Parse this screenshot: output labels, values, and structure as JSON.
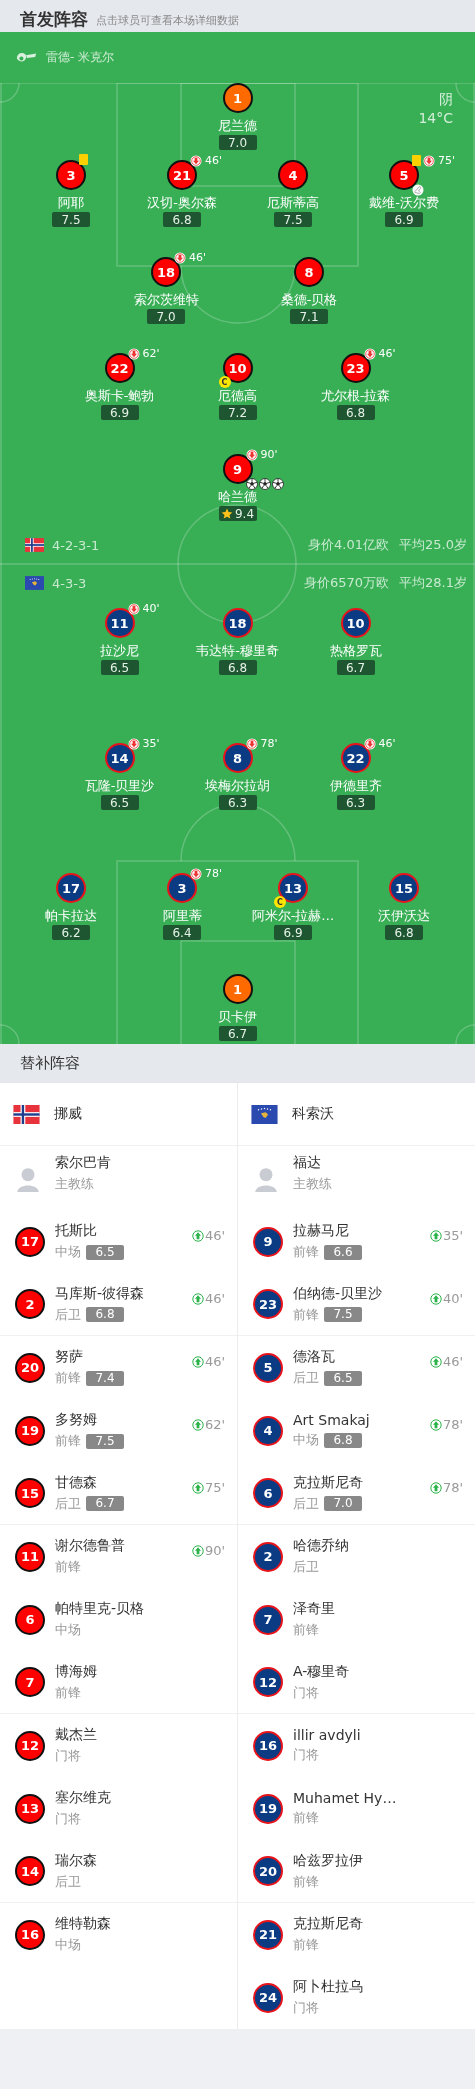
{
  "header": {
    "title": "首发阵容",
    "hint": "点击球员可查看本场详细数据"
  },
  "lineup": {
    "referee": "雷德- 米克尔",
    "weather": {
      "condition": "阴",
      "temperature": "14°C"
    },
    "home": {
      "formation": "4-2-3-1",
      "value": "身价4.01亿欧",
      "avg_age": "平均25.0岁",
      "lines": [
        [
          {
            "number": "1",
            "name": "尼兰德",
            "rating": "7.0",
            "kind": "goalkeeper",
            "yellow_card": false,
            "mvp": false
          }
        ],
        [
          {
            "number": "3",
            "name": "阿耶",
            "rating": "7.5",
            "kind": "outfield",
            "yellow_card": true,
            "mvp": false
          },
          {
            "number": "21",
            "name": "汉切-奥尔森",
            "rating": "6.8",
            "kind": "outfield",
            "yellow_card": false,
            "mvp": false,
            "sub_minute": "46'"
          },
          {
            "number": "4",
            "name": "厄斯蒂高",
            "rating": "7.5",
            "kind": "outfield",
            "yellow_card": false,
            "mvp": false
          },
          {
            "number": "5",
            "name": "戴维-沃尔费",
            "rating": "6.9",
            "kind": "outfield",
            "yellow_card": true,
            "mvp": false,
            "sub_minute": "75'",
            "events": [
              {
                "kind": "assist"
              }
            ]
          }
        ],
        [
          {
            "number": "18",
            "name": "索尔茨维特",
            "rating": "7.0",
            "kind": "outfield",
            "yellow_card": false,
            "mvp": false,
            "sub_minute": "46'"
          },
          {
            "number": "8",
            "name": "桑德-贝格",
            "rating": "7.1",
            "kind": "outfield",
            "yellow_card": false,
            "mvp": false
          }
        ],
        [
          {
            "number": "22",
            "name": "奥斯卡-鲍勃",
            "rating": "6.9",
            "kind": "outfield",
            "yellow_card": false,
            "mvp": false,
            "sub_minute": "62'"
          },
          {
            "number": "10",
            "name": "厄德高",
            "rating": "7.2",
            "kind": "outfield",
            "yellow_card": false,
            "mvp": false,
            "captain": "C"
          },
          {
            "number": "23",
            "name": "尤尔根-拉森",
            "rating": "6.8",
            "kind": "outfield",
            "yellow_card": false,
            "mvp": false,
            "sub_minute": "46'"
          }
        ],
        [
          {
            "number": "9",
            "name": "哈兰德",
            "rating": "9.4",
            "kind": "outfield",
            "yellow_card": false,
            "mvp": true,
            "sub_minute": "90'",
            "events": [
              {
                "kind": "goal"
              },
              {
                "kind": "goal"
              },
              {
                "kind": "goal"
              }
            ]
          }
        ]
      ]
    },
    "away": {
      "formation": "4-3-3",
      "value": "身价6570万欧",
      "avg_age": "平均28.1岁",
      "lines": [
        [
          {
            "number": "11",
            "name": "拉沙尼",
            "rating": "6.5",
            "kind": "outfield",
            "yellow_card": false,
            "mvp": false,
            "sub_minute": "40'"
          },
          {
            "number": "18",
            "name": "韦达特-穆里奇",
            "rating": "6.8",
            "kind": "outfield",
            "yellow_card": false,
            "mvp": false
          },
          {
            "number": "10",
            "name": "热格罗瓦",
            "rating": "6.7",
            "kind": "outfield",
            "yellow_card": false,
            "mvp": false
          }
        ],
        [
          {
            "number": "14",
            "name": "瓦隆-贝里沙",
            "rating": "6.5",
            "kind": "outfield",
            "yellow_card": false,
            "mvp": false,
            "sub_minute": "35'"
          },
          {
            "number": "8",
            "name": "埃梅尔拉胡",
            "rating": "6.3",
            "kind": "outfield",
            "yellow_card": false,
            "mvp": false,
            "sub_minute": "78'"
          },
          {
            "number": "22",
            "name": "伊德里齐",
            "rating": "6.3",
            "kind": "outfield",
            "yellow_card": false,
            "mvp": false,
            "sub_minute": "46'"
          }
        ],
        [
          {
            "number": "17",
            "name": "帕卡拉达",
            "rating": "6.2",
            "kind": "outfield",
            "yellow_card": false,
            "mvp": false
          },
          {
            "number": "3",
            "name": "阿里蒂",
            "rating": "6.4",
            "kind": "outfield",
            "yellow_card": false,
            "mvp": false,
            "sub_minute": "78'"
          },
          {
            "number": "13",
            "name": "阿米尔-拉赫…",
            "rating": "6.9",
            "kind": "outfield",
            "yellow_card": false,
            "mvp": false,
            "captain": "C"
          },
          {
            "number": "15",
            "name": "沃伊沃达",
            "rating": "6.8",
            "kind": "outfield",
            "yellow_card": false,
            "mvp": false
          }
        ],
        [
          {
            "number": "1",
            "name": "贝卡伊",
            "rating": "6.7",
            "kind": "goalkeeper",
            "yellow_card": false,
            "mvp": false
          }
        ]
      ]
    }
  },
  "substitutes": {
    "title": "替补阵容",
    "teams": [
      {
        "name": "挪威",
        "coach": {
          "name": "索尔巴肯",
          "role": "主教练"
        },
        "players": [
          {
            "number": "17",
            "name": "托斯比",
            "position": "中场",
            "rating": "6.5",
            "sub_minute": "46'"
          },
          {
            "number": "2",
            "name": "马库斯-彼得森",
            "position": "后卫",
            "rating": "6.8",
            "sub_minute": "46'"
          },
          {
            "number": "20",
            "name": "努萨",
            "position": "前锋",
            "rating": "7.4",
            "sub_minute": "46'"
          },
          {
            "number": "19",
            "name": "多努姆",
            "position": "前锋",
            "rating": "7.5",
            "sub_minute": "62'"
          },
          {
            "number": "15",
            "name": "甘德森",
            "position": "后卫",
            "rating": "6.7",
            "sub_minute": "75'"
          },
          {
            "number": "11",
            "name": "谢尔德鲁普",
            "position": "前锋",
            "sub_minute": "90'"
          },
          {
            "number": "6",
            "name": "帕特里克-贝格",
            "position": "中场"
          },
          {
            "number": "7",
            "name": "博海姆",
            "position": "前锋"
          },
          {
            "number": "12",
            "name": "戴杰兰",
            "position": "门将"
          },
          {
            "number": "13",
            "name": "塞尔维克",
            "position": "门将"
          },
          {
            "number": "14",
            "name": "瑞尔森",
            "position": "后卫"
          },
          {
            "number": "16",
            "name": "维特勒森",
            "position": "中场"
          }
        ]
      },
      {
        "name": "科索沃",
        "coach": {
          "name": "福达",
          "role": "主教练"
        },
        "players": [
          {
            "number": "9",
            "name": "拉赫马尼",
            "position": "前锋",
            "rating": "6.6",
            "sub_minute": "35'"
          },
          {
            "number": "23",
            "name": "伯纳德-贝里沙",
            "position": "前锋",
            "rating": "7.5",
            "sub_minute": "40'"
          },
          {
            "number": "5",
            "name": "德洛瓦",
            "position": "后卫",
            "rating": "6.5",
            "sub_minute": "46'"
          },
          {
            "number": "4",
            "name": "Art Smakaj",
            "position": "中场",
            "rating": "6.8",
            "sub_minute": "78'"
          },
          {
            "number": "6",
            "name": "克拉斯尼奇",
            "position": "后卫",
            "rating": "7.0",
            "sub_minute": "78'"
          },
          {
            "number": "2",
            "name": "哈德乔纳",
            "position": "后卫"
          },
          {
            "number": "7",
            "name": "泽奇里",
            "position": "前锋"
          },
          {
            "number": "12",
            "name": "A-穆里奇",
            "position": "门将"
          },
          {
            "number": "16",
            "name": "illir avdyli",
            "position": "门将"
          },
          {
            "number": "19",
            "name": "Muhamet Hy…",
            "position": "前锋"
          },
          {
            "number": "20",
            "name": "哈兹罗拉伊",
            "position": "前锋"
          },
          {
            "number": "21",
            "name": "克拉斯尼奇",
            "position": "前锋"
          },
          {
            "number": "24",
            "name": "阿卜杜拉乌",
            "position": "门将"
          }
        ]
      }
    ]
  }
}
